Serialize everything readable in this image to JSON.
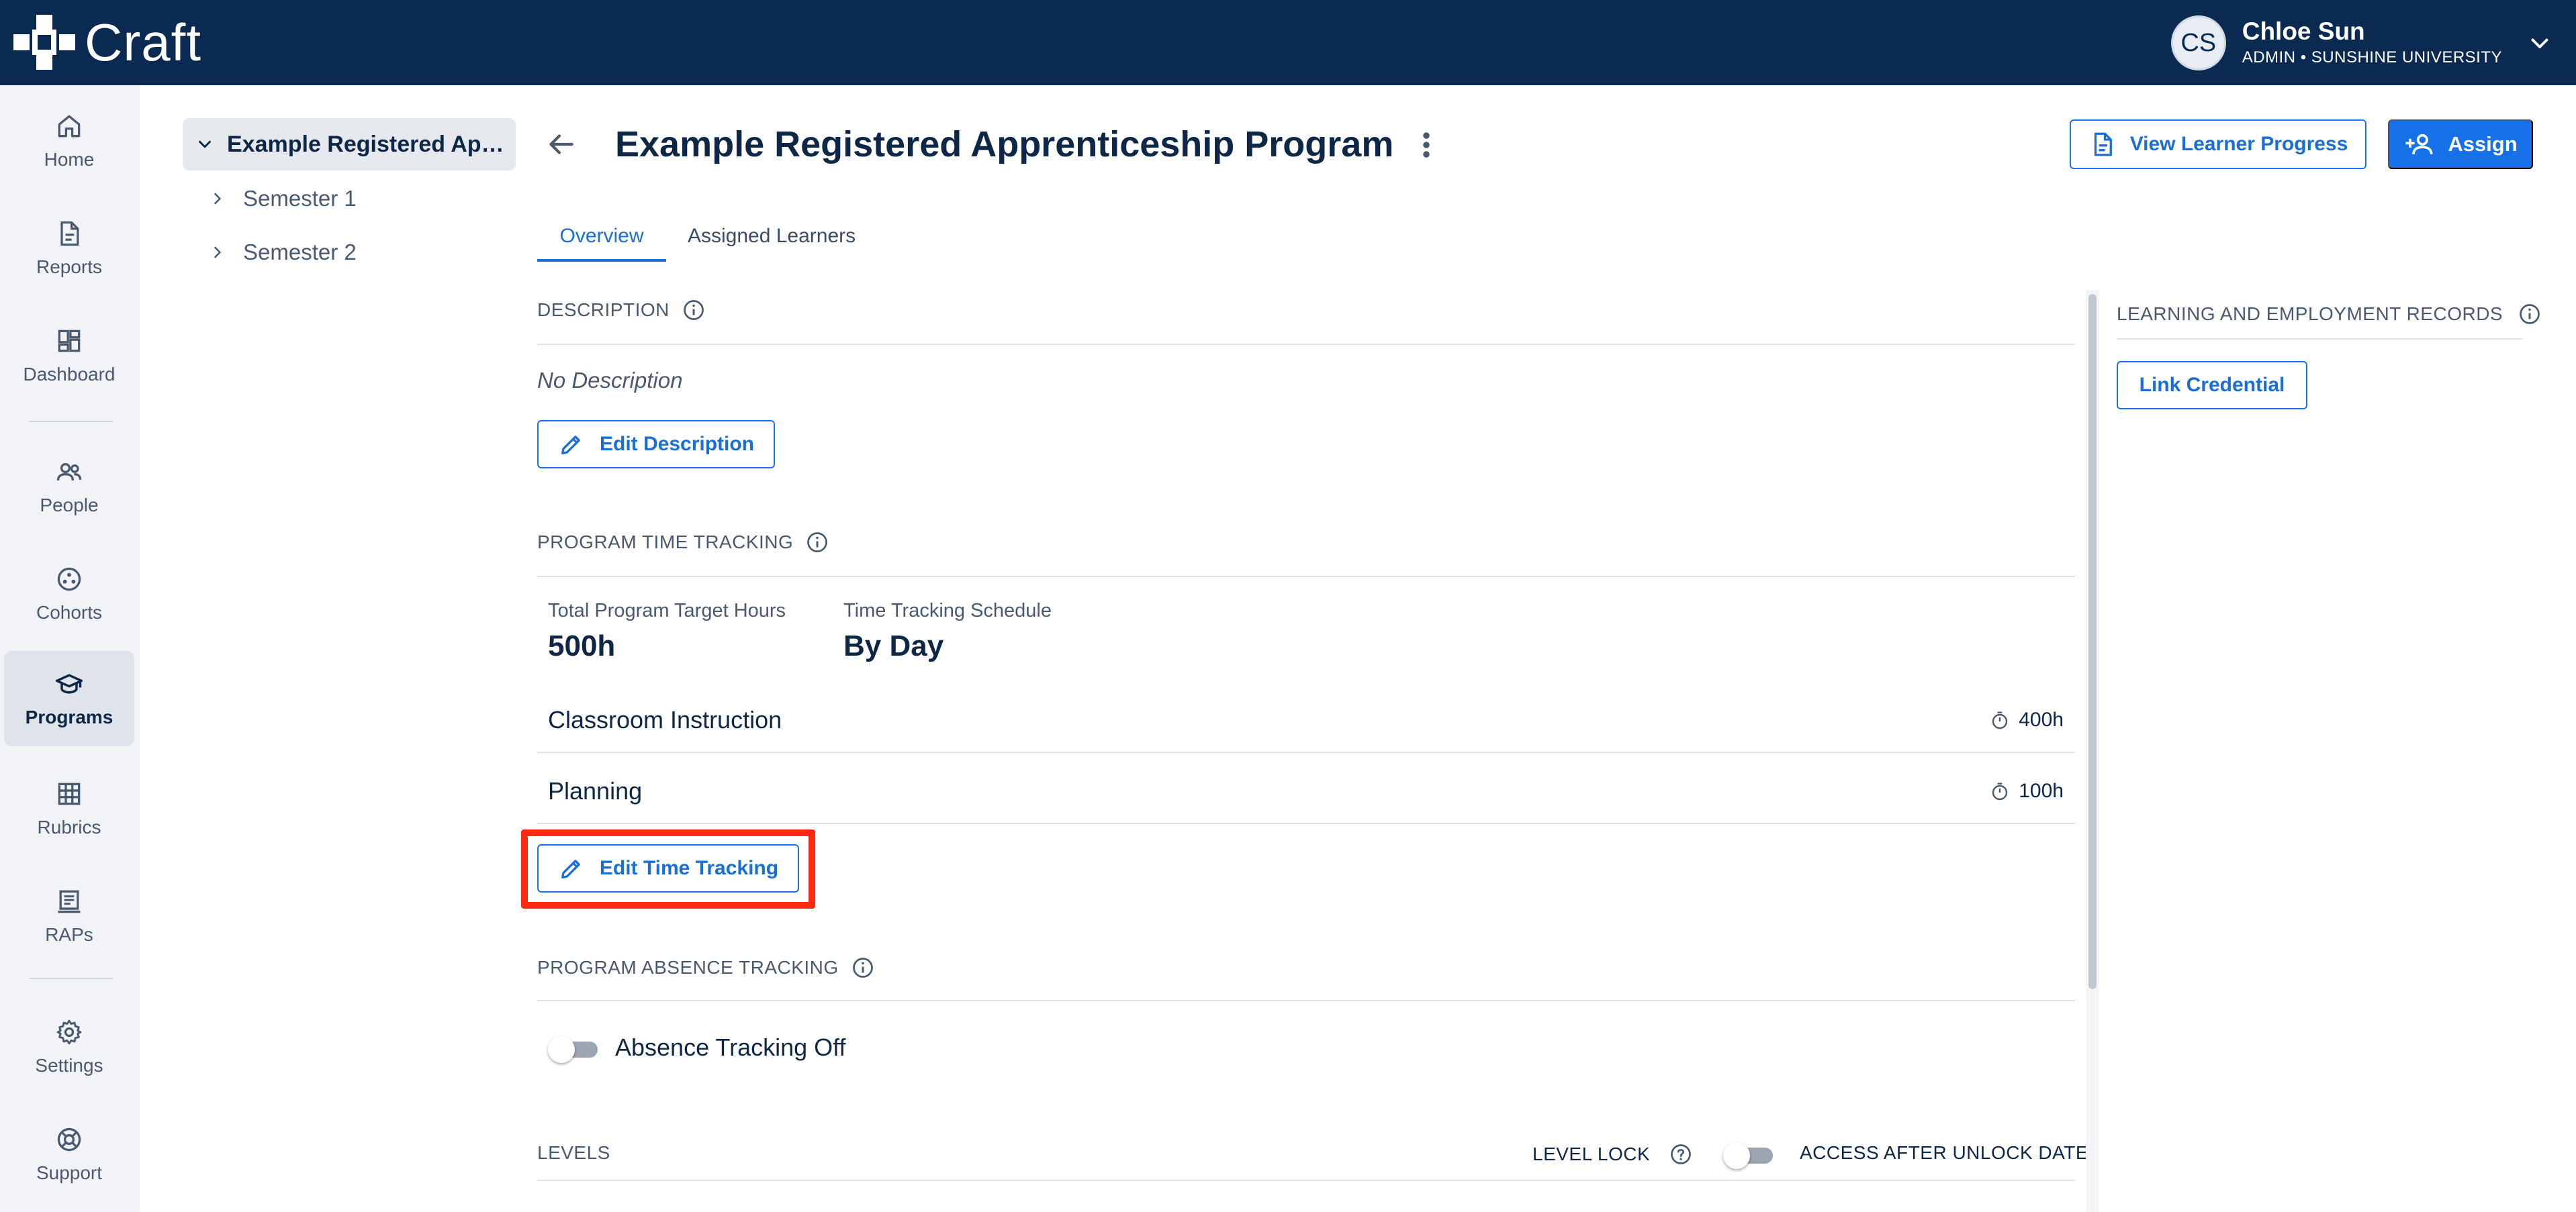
{
  "app": {
    "name": "Craft"
  },
  "user": {
    "initials": "CS",
    "name": "Chloe Sun",
    "role": "ADMIN • SUNSHINE UNIVERSITY"
  },
  "nav": [
    {
      "label": "Home",
      "icon": "home-icon"
    },
    {
      "label": "Reports",
      "icon": "report-icon"
    },
    {
      "label": "Dashboard",
      "icon": "dashboard-icon"
    },
    {
      "label": "People",
      "icon": "people-icon"
    },
    {
      "label": "Cohorts",
      "icon": "cohorts-icon"
    },
    {
      "label": "Programs",
      "icon": "graduation-cap-icon",
      "active": true
    },
    {
      "label": "Rubrics",
      "icon": "grid-icon"
    },
    {
      "label": "RAPs",
      "icon": "rap-icon"
    },
    {
      "label": "Settings",
      "icon": "gear-icon"
    },
    {
      "label": "Support",
      "icon": "lifebuoy-icon"
    }
  ],
  "tree": {
    "root": "Example Registered Apprenticeship Program",
    "children": [
      "Semester 1",
      "Semester 2"
    ]
  },
  "header": {
    "title": "Example Registered Apprenticeship Program",
    "view_progress": "View Learner Progress",
    "assign": "Assign"
  },
  "tabs": [
    "Overview",
    "Assigned Learners"
  ],
  "description": {
    "label": "DESCRIPTION",
    "text": "No Description",
    "edit_button": "Edit Description"
  },
  "time_tracking": {
    "label": "PROGRAM TIME TRACKING",
    "target_label": "Total Program Target Hours",
    "target_value": "500h",
    "schedule_label": "Time Tracking Schedule",
    "schedule_value": "By Day",
    "rows": [
      {
        "name": "Classroom Instruction",
        "hours": "400h"
      },
      {
        "name": "Planning",
        "hours": "100h"
      }
    ],
    "edit_button": "Edit Time Tracking"
  },
  "absence": {
    "label": "PROGRAM ABSENCE TRACKING",
    "toggle_label": "Absence Tracking Off",
    "enabled": false
  },
  "levels": {
    "label": "LEVELS",
    "lock_label": "LEVEL LOCK",
    "access_label": "ACCESS AFTER UNLOCK DATE",
    "lock_enabled": false
  },
  "records": {
    "label": "LEARNING AND EMPLOYMENT RECORDS",
    "link_button": "Link Credential"
  },
  "colors": {
    "topbar": "#0b2a52",
    "accent": "#1670e8",
    "highlight": "#ff2a12"
  }
}
